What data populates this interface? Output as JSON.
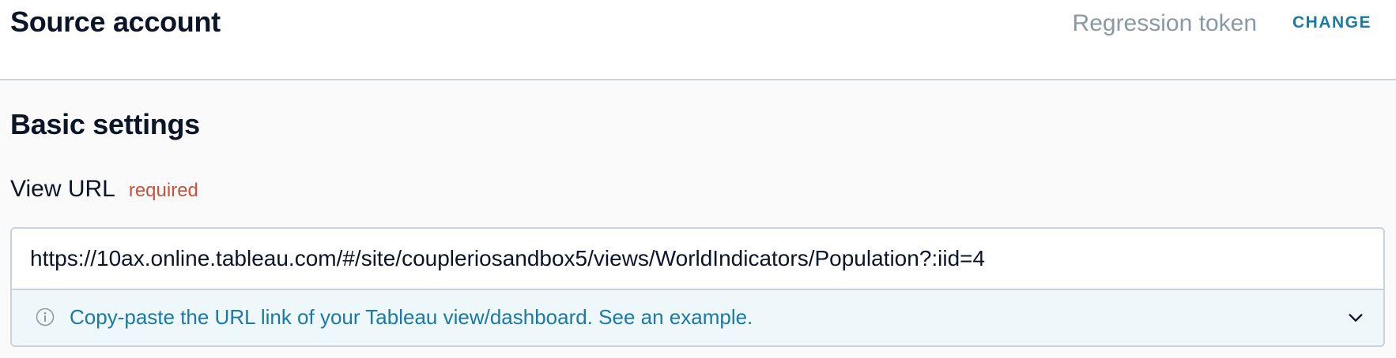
{
  "source": {
    "title": "Source account",
    "account_name": "Regression token",
    "change_label": "CHANGE"
  },
  "basic_settings": {
    "title": "Basic settings",
    "view_url": {
      "label": "View URL",
      "required_label": "required",
      "value": "https://10ax.online.tableau.com/#/site/coupleriosandbox5/views/WorldIndicators/Population?:iid=4",
      "hint": "Copy-paste the URL link of your Tableau view/dashboard. See an example.",
      "hint_icon": "info-icon",
      "expand_icon": "chevron-down-icon"
    }
  },
  "colors": {
    "accent": "#1b7aa3",
    "required": "#c9513b",
    "muted": "#8a9aa3",
    "hint_background": "#eef7fa"
  }
}
